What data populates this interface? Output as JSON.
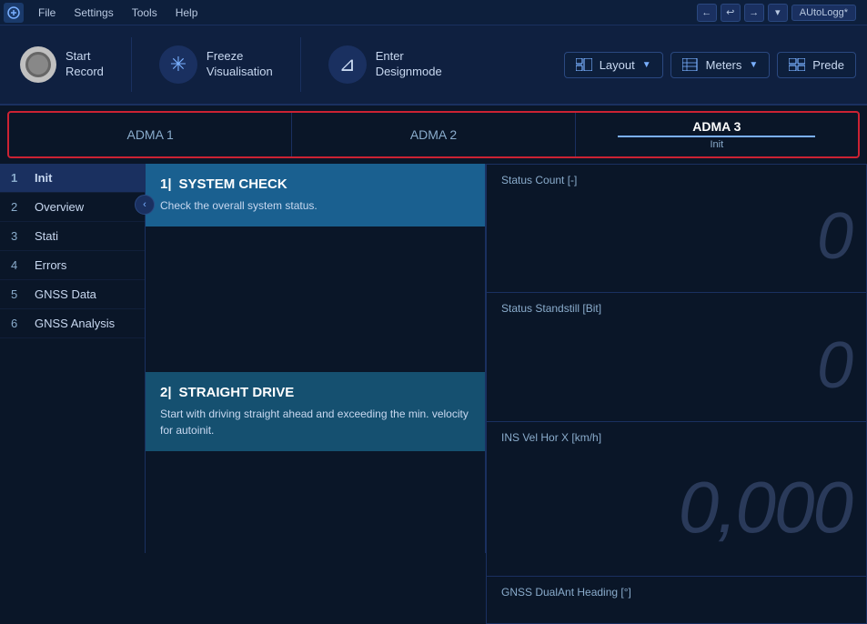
{
  "menubar": {
    "logo": "AW",
    "items": [
      "File",
      "Settings",
      "Tools",
      "Help"
    ],
    "tag": "AUtoLogg*",
    "undo_label": "←",
    "redo_label": "→",
    "more_label": "▾"
  },
  "toolbar": {
    "record_label": "Start\nRecord",
    "freeze_label": "Freeze\nVisualisation",
    "enter_design_label": "Enter\nDesignmode",
    "layout_label": "Layout",
    "meters_label": "Meters",
    "prede_label": "Prede"
  },
  "tabs": [
    {
      "id": "adma1",
      "label": "ADMA 1",
      "active": false
    },
    {
      "id": "adma2",
      "label": "ADMA 2",
      "active": false
    },
    {
      "id": "adma3",
      "label": "ADMA 3",
      "active": true,
      "sublabel": "Init"
    }
  ],
  "sidebar": {
    "items": [
      {
        "num": "1",
        "label": "Init",
        "active": true
      },
      {
        "num": "2",
        "label": "Overview",
        "active": false
      },
      {
        "num": "3",
        "label": "Stati",
        "active": false
      },
      {
        "num": "4",
        "label": "Errors",
        "active": false
      },
      {
        "num": "5",
        "label": "GNSS Data",
        "active": false
      },
      {
        "num": "6",
        "label": "GNSS Analysis",
        "active": false
      }
    ]
  },
  "steps": [
    {
      "num": "1|",
      "title": "SYSTEM CHECK",
      "desc": "Check the overall system status."
    },
    {
      "num": "2|",
      "title": "STRAIGHT DRIVE",
      "desc": "Start with driving straight ahead and exceeding the min. velocity for autoinit."
    }
  ],
  "metrics": [
    {
      "label": "Status Count  [-]",
      "value": "0"
    },
    {
      "label": "Status Standstill  [Bit]",
      "value": "0"
    },
    {
      "label": "INS Vel Hor X  [km/h]",
      "value": "0,000"
    },
    {
      "label": "GNSS DualAnt Heading  [°]",
      "value": ""
    }
  ],
  "collapse_btn": "‹"
}
